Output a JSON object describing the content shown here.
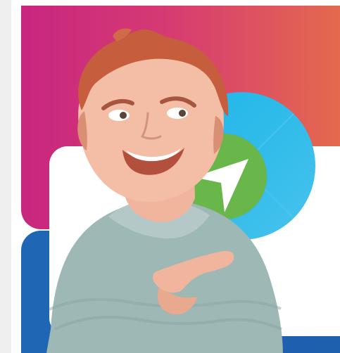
{
  "colors": {
    "magenta": "#c8267f",
    "orange": "#e4694e",
    "blue": "#1f66b5",
    "cyan": "#1db6e9",
    "green": "#69b64a",
    "white": "#ffffff"
  },
  "icons": {
    "navigation": "navigation-arrow-icon"
  }
}
